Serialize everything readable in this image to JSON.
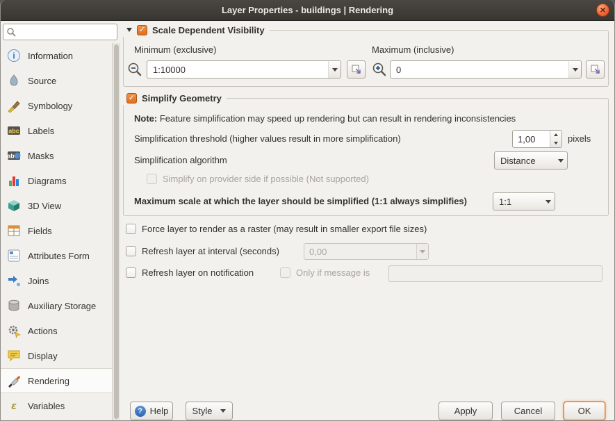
{
  "window": {
    "title": "Layer Properties - buildings | Rendering"
  },
  "colors": {
    "accent_orange": "#e87b33",
    "titlebar_bg": "#3c3a36",
    "selection_bg": "#fbfbfa",
    "window_bg": "#f2f1ed"
  },
  "sidebar": {
    "search_placeholder": "",
    "search_value": "",
    "items": [
      {
        "label": "Information",
        "icon": "information-icon",
        "selected": false
      },
      {
        "label": "Source",
        "icon": "source-icon",
        "selected": false
      },
      {
        "label": "Symbology",
        "icon": "symbology-icon",
        "selected": false
      },
      {
        "label": "Labels",
        "icon": "labels-icon",
        "selected": false
      },
      {
        "label": "Masks",
        "icon": "masks-icon",
        "selected": false
      },
      {
        "label": "Diagrams",
        "icon": "diagrams-icon",
        "selected": false
      },
      {
        "label": "3D View",
        "icon": "3d-view-icon",
        "selected": false
      },
      {
        "label": "Fields",
        "icon": "fields-icon",
        "selected": false
      },
      {
        "label": "Attributes Form",
        "icon": "attributes-form-icon",
        "selected": false
      },
      {
        "label": "Joins",
        "icon": "joins-icon",
        "selected": false
      },
      {
        "label": "Auxiliary Storage",
        "icon": "auxiliary-storage-icon",
        "selected": false
      },
      {
        "label": "Actions",
        "icon": "actions-icon",
        "selected": false
      },
      {
        "label": "Display",
        "icon": "display-icon",
        "selected": false
      },
      {
        "label": "Rendering",
        "icon": "rendering-icon",
        "selected": true
      },
      {
        "label": "Variables",
        "icon": "variables-icon",
        "selected": false
      }
    ]
  },
  "main": {
    "scale_group": {
      "title": "Scale Dependent Visibility",
      "checked": true,
      "min_label": "Minimum (exclusive)",
      "max_label": "Maximum (inclusive)",
      "min_value": "1:10000",
      "max_value": "0"
    },
    "simplify_group": {
      "title": "Simplify Geometry",
      "checked": true,
      "note_prefix": "Note:",
      "note_text": "Feature simplification may speed up rendering but can result in rendering inconsistencies",
      "threshold_label": "Simplification threshold (higher values result in more simplification)",
      "threshold_value": "1,00",
      "threshold_unit": "pixels",
      "algorithm_label": "Simplification algorithm",
      "algorithm_value": "Distance",
      "provider_label": "Simplify on provider side if possible (Not supported)",
      "provider_enabled": false,
      "max_scale_label": "Maximum scale at which the layer should be simplified (1:1 always simplifies)",
      "max_scale_value": "1:1"
    },
    "options": {
      "force_raster_label": "Force layer to render as a raster (may result in smaller export file sizes)",
      "force_raster_checked": false,
      "refresh_interval_label": "Refresh layer at interval (seconds)",
      "refresh_interval_checked": false,
      "refresh_interval_value": "0,00",
      "refresh_notification_label": "Refresh layer on notification",
      "refresh_notification_checked": false,
      "only_if_label": "Only if message is",
      "notification_message_value": ""
    }
  },
  "footer": {
    "help": "Help",
    "style": "Style",
    "apply": "Apply",
    "cancel": "Cancel",
    "ok": "OK"
  }
}
